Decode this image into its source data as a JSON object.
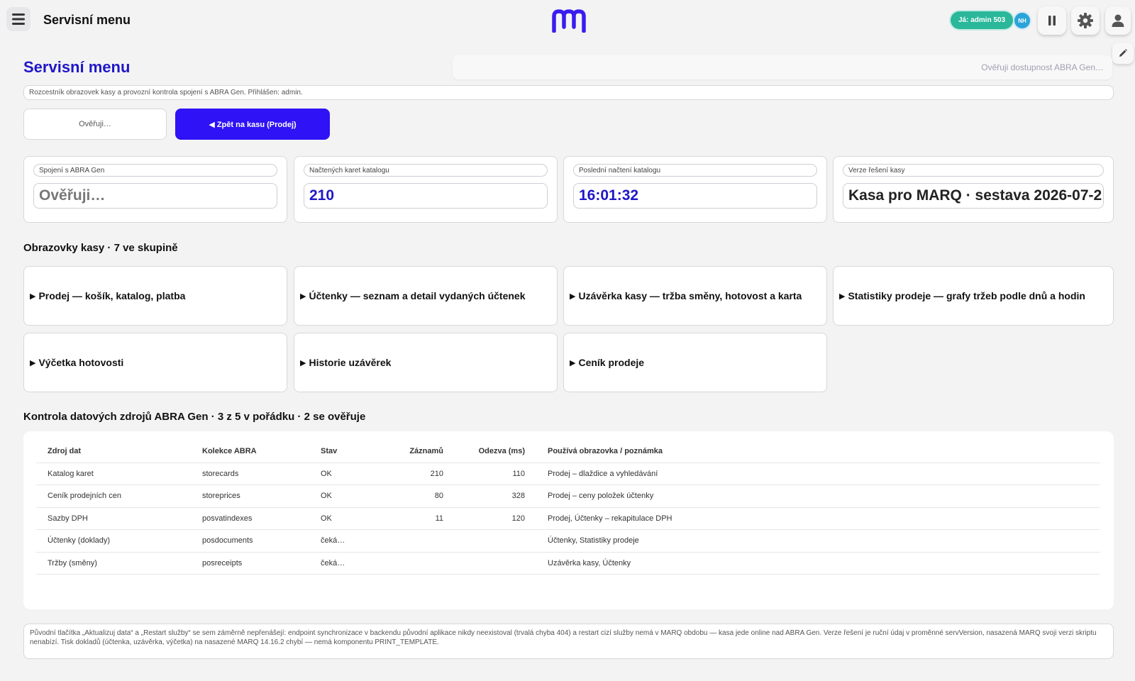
{
  "header": {
    "title": "Servisní menu",
    "user_label": "Já: admin 503",
    "initials": "NH",
    "icons": {
      "menu": "hamburger-icon",
      "pause": "pause-icon",
      "settings": "gear-icon",
      "user": "user-icon",
      "edit": "pencil-icon"
    }
  },
  "page": {
    "title": "Servisní menu",
    "availability": "Ověřuji dostupnost ABRA Gen…",
    "subtitle": "Rozcestník obrazovek kasy a provozní kontrola spojení s ABRA Gen. Přihlášen: admin.",
    "verify_button": "Ověřuji…",
    "back_button": "◀ Zpět na kasu (Prodej)"
  },
  "stats": [
    {
      "label": "Spojení s ABRA Gen",
      "value": "Ověřuji…"
    },
    {
      "label": "Načtených karet katalogu",
      "value": "210"
    },
    {
      "label": "Poslední načtení katalogu",
      "value": "16:01:32"
    },
    {
      "label": "Verze řešení kasy",
      "value": "Kasa pro MARQ · sestava 2026-07-2"
    }
  ],
  "screens": {
    "title": "Obrazovky kasy · 7 ve skupině",
    "items": [
      "Prodej — košík, katalog, platba",
      "Účtenky — seznam a detail vydaných účtenek",
      "Uzávěrka kasy — tržba směny, hotovost a karta",
      "Statistiky prodeje — grafy tržeb podle dnů a hodin",
      "Výčetka hotovosti",
      "Historie uzávěrek",
      "Ceník prodeje"
    ]
  },
  "sources": {
    "title": "Kontrola datových zdrojů ABRA Gen · 3 z 5 v pořádku · 2 se ověřuje",
    "columns": [
      "Zdroj dat",
      "Kolekce ABRA",
      "Stav",
      "Záznamů",
      "Odezva (ms)",
      "Používá obrazovka / poznámka"
    ],
    "rows": [
      {
        "source": "Katalog karet",
        "collection": "storecards",
        "status": "OK",
        "records": "210",
        "latency": "110",
        "note": "Prodej – dlaždice a vyhledávání"
      },
      {
        "source": "Ceník prodejních cen",
        "collection": "storeprices",
        "status": "OK",
        "records": "80",
        "latency": "328",
        "note": "Prodej – ceny položek účtenky"
      },
      {
        "source": "Sazby DPH",
        "collection": "posvatindexes",
        "status": "OK",
        "records": "11",
        "latency": "120",
        "note": "Prodej, Účtenky – rekapitulace DPH"
      },
      {
        "source": "Účtenky (doklady)",
        "collection": "posdocuments",
        "status": "čeká…",
        "records": "",
        "latency": "",
        "note": "Účtenky, Statistiky prodeje"
      },
      {
        "source": "Tržby (směny)",
        "collection": "posreceipts",
        "status": "čeká…",
        "records": "",
        "latency": "",
        "note": "Uzávěrka kasy, Účtenky"
      }
    ]
  },
  "footnote": "Původní tlačítka „Aktualizuj data“ a „Restart služby“ se sem záměrně nepřenášejí: endpoint synchronizace v backendu původní aplikace nikdy neexistoval (trvalá chyba 404) a restart cizí služby nemá v MARQ obdobu — kasa jede online nad ABRA Gen. Verze řešení je ruční údaj v proměnné servVersion, nasazená MARQ svoji verzi skriptu nenabízí. Tisk dokladů (účtenka, uzávěrka, výčetka) na nasazené MARQ 14.16.2 chybí — nemá komponentu PRINT_TEMPLATE.",
  "colors": {
    "accent": "#1f17c8",
    "primary_button": "#2f12f5",
    "user_pill": "#2ab79a",
    "initials_badge": "#2aa4d8",
    "logo": "#3a1cf0"
  }
}
